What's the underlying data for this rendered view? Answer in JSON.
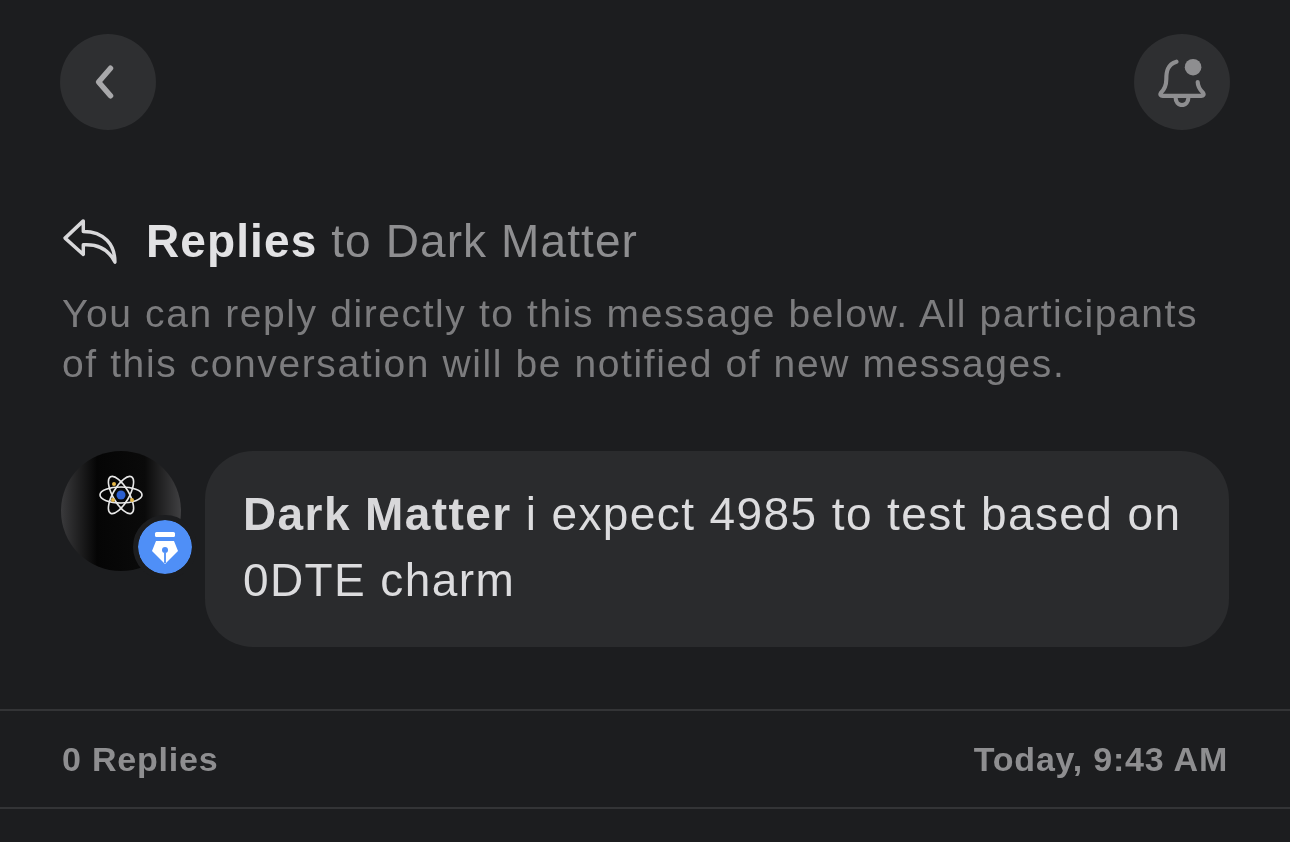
{
  "header": {
    "title": "**Replies** to Dark Matter"
  },
  "description": "You can reply directly to this message below. All participants of this conversation will be notified of new messages.",
  "message": {
    "text": "**Dark Matter** i expect 4985 to test based on 0DTE charm"
  },
  "footer": {
    "reply_count": "0 Replies",
    "timestamp": "Today, 9:43 AM"
  }
}
